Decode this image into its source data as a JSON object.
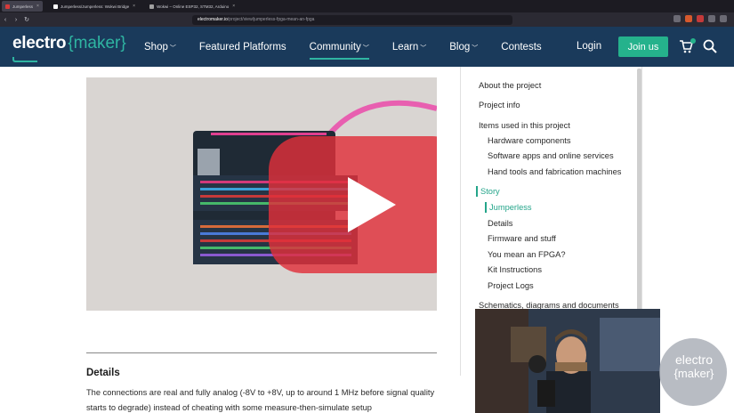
{
  "browser": {
    "tabs": [
      {
        "label": "Jumperless",
        "active": true,
        "color": "#d63a3a"
      },
      {
        "label": "Jumperless/Jumperless: Wokwi Bridge",
        "active": false,
        "color": "#ffffff"
      },
      {
        "label": "Wokwi – Online ESP32, STM32, Arduino",
        "active": false,
        "color": "#a0a0a0"
      }
    ],
    "url_host": "electromaker.io",
    "url_path": "/project/view/jumperless-fpga-mean-an-fpga"
  },
  "header": {
    "logo_main": "electro",
    "logo_accent": "{maker}",
    "nav": [
      {
        "label": "Shop",
        "chevron": true,
        "active": false
      },
      {
        "label": "Featured Platforms",
        "chevron": false,
        "active": false
      },
      {
        "label": "Community",
        "chevron": true,
        "active": true
      },
      {
        "label": "Learn",
        "chevron": true,
        "active": false
      },
      {
        "label": "Blog",
        "chevron": true,
        "active": false
      },
      {
        "label": "Contests",
        "chevron": false,
        "active": false
      }
    ],
    "login": "Login",
    "join": "Join us",
    "cart_count": "0"
  },
  "content": {
    "details_heading": "Details",
    "details_text": "The connections are real and fully analog (-8V to +8V, up to around 1 MHz before signal quality starts to degrade) instead of cheating with some measure-then-simulate setup"
  },
  "toc": {
    "items": [
      {
        "label": "About the project",
        "level": 1,
        "active": false
      },
      {
        "label": "Project info",
        "level": 1,
        "active": false
      },
      {
        "label": "Items used in this project",
        "level": 1,
        "active": false
      },
      {
        "label": "Hardware components",
        "level": 2,
        "active": false
      },
      {
        "label": "Software apps and online services",
        "level": 2,
        "active": false
      },
      {
        "label": "Hand tools and fabrication machines",
        "level": 2,
        "active": false
      },
      {
        "label": "Story",
        "level": 1,
        "active": true
      },
      {
        "label": "Jumperless",
        "level": 2,
        "active": true
      },
      {
        "label": "Details",
        "level": 2,
        "active": false
      },
      {
        "label": "Firmware and stuff",
        "level": 2,
        "active": false
      },
      {
        "label": "You mean an FPGA?",
        "level": 2,
        "active": false
      },
      {
        "label": "Kit Instructions",
        "level": 2,
        "active": false
      },
      {
        "label": "Project Logs",
        "level": 2,
        "active": false
      },
      {
        "label": "Schematics, diagrams and documents",
        "level": 1,
        "active": false
      }
    ]
  },
  "watermark": {
    "line1": "electro",
    "line2": "{maker}"
  },
  "colors": {
    "brand_navy": "#1a3a5b",
    "brand_teal": "#2fb5a2",
    "join_green": "#25b28c",
    "play_red": "#e0303a"
  }
}
